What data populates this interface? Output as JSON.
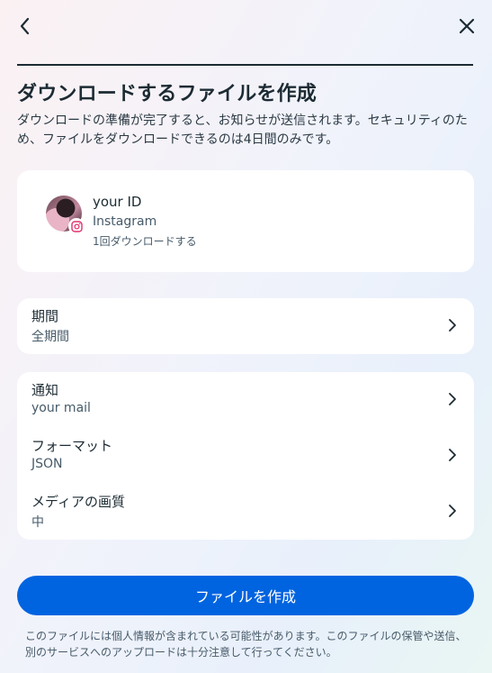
{
  "header": {
    "back_icon": "chevron-left-icon",
    "close_icon": "close-icon"
  },
  "title": "ダウンロードするファイルを作成",
  "description": "ダウンロードの準備が完了すると、お知らせが送信されます。セキュリティのため、ファイルをダウンロードできるのは4日間のみです。",
  "account": {
    "name": "your ID",
    "platform": "Instagram",
    "download_count": "1回ダウンロードする",
    "badge_icon": "instagram-icon"
  },
  "settings": {
    "period": {
      "label": "期間",
      "value": "全期間"
    },
    "notification": {
      "label": "通知",
      "value": "your mail"
    },
    "format": {
      "label": "フォーマット",
      "value": "JSON"
    },
    "media_quality": {
      "label": "メディアの画質",
      "value": "中"
    }
  },
  "create_button": "ファイルを作成",
  "footnote": "このファイルには個人情報が含まれている可能性があります。このファイルの保管や送信、別のサービスへのアップロードは十分注意して行ってください。",
  "colors": {
    "primary": "#0064e0",
    "text": "#1c2b33",
    "instagram": "#e1306c"
  }
}
